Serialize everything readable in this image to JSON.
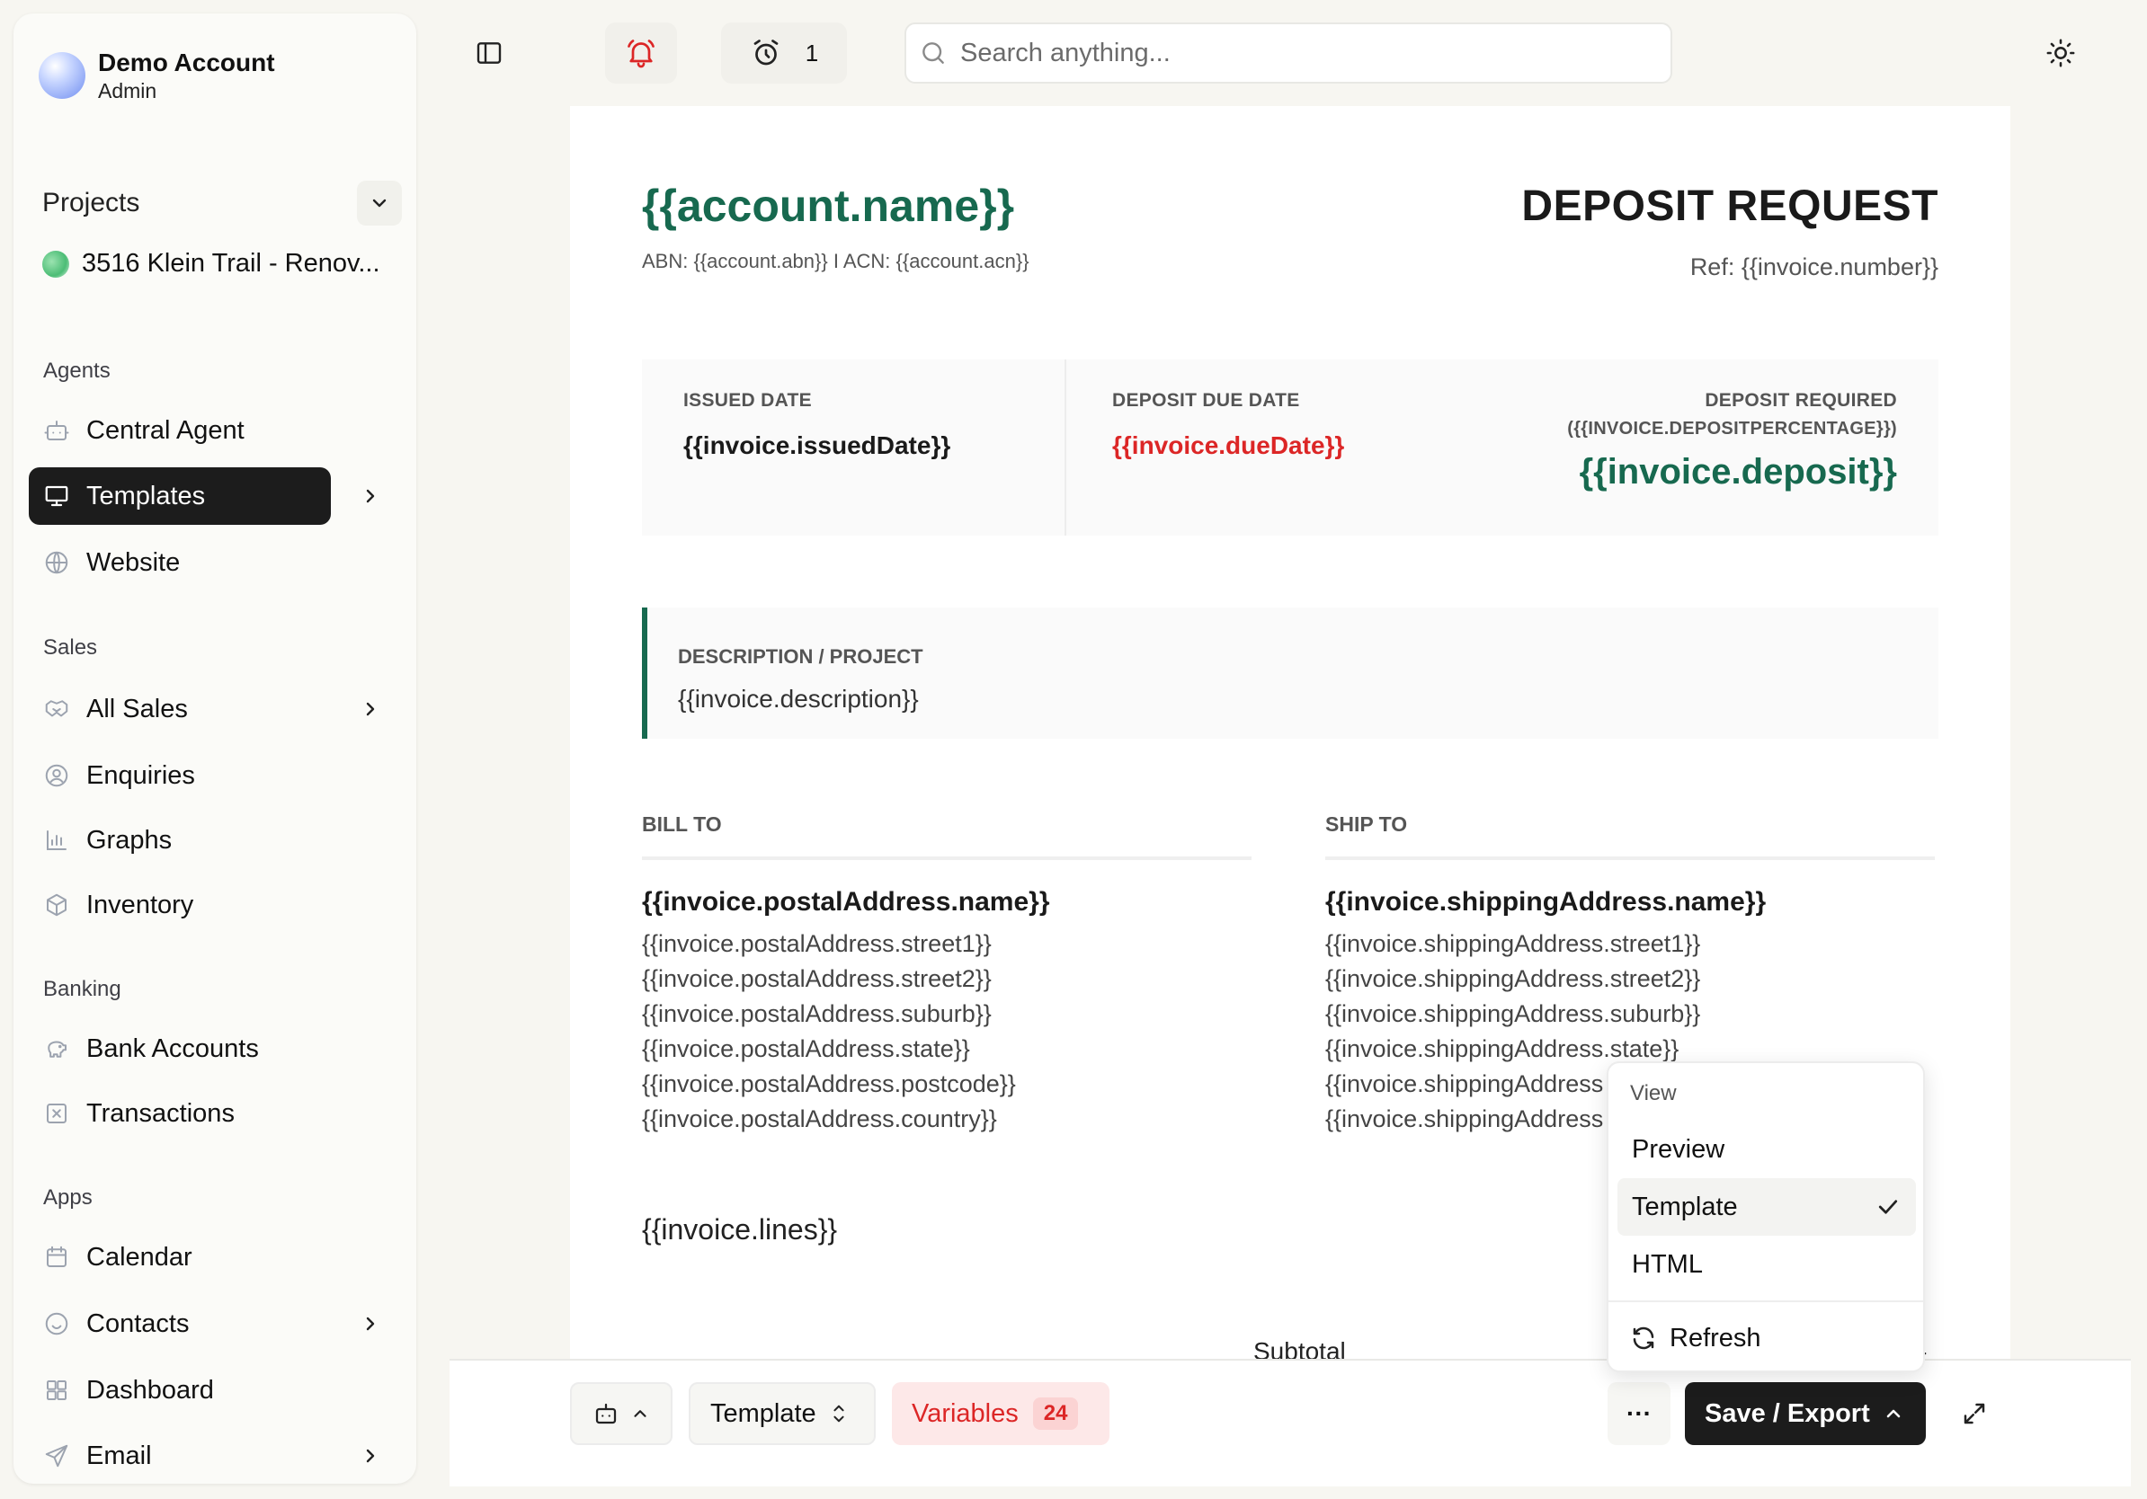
{
  "account": {
    "name": "Demo Account",
    "role": "Admin"
  },
  "projects": {
    "label": "Projects",
    "current": "3516 Klein Trail - Renov..."
  },
  "sidebar": {
    "sections": {
      "agents": "Agents",
      "sales": "Sales",
      "banking": "Banking",
      "apps": "Apps"
    },
    "items": {
      "central_agent": "Central Agent",
      "templates": "Templates",
      "website": "Website",
      "all_sales": "All Sales",
      "enquiries": "Enquiries",
      "graphs": "Graphs",
      "inventory": "Inventory",
      "bank_accounts": "Bank Accounts",
      "transactions": "Transactions",
      "calendar": "Calendar",
      "contacts": "Contacts",
      "dashboard": "Dashboard",
      "email": "Email"
    }
  },
  "topbar": {
    "alarm_count": "1",
    "search_placeholder": "Search anything..."
  },
  "document": {
    "account_name": "{{account.name}}",
    "account_sub": "ABN: {{account.abn}} I ACN: {{account.acn}}",
    "title": "DEPOSIT REQUEST",
    "ref": "Ref: {{invoice.number}}",
    "issued_label": "ISSUED DATE",
    "issued_value": "{{invoice.issuedDate}}",
    "due_label": "DEPOSIT DUE DATE",
    "due_value": "{{invoice.dueDate}}",
    "deposit_label": "DEPOSIT REQUIRED",
    "deposit_percent": "({{INVOICE.DEPOSITPERCENTAGE}})",
    "deposit_value": "{{invoice.deposit}}",
    "description_label": "DESCRIPTION / PROJECT",
    "description_value": "{{invoice.description}}",
    "bill_to": {
      "label": "BILL TO",
      "name": "{{invoice.postalAddress.name}}",
      "lines": [
        "{{invoice.postalAddress.street1}}",
        "{{invoice.postalAddress.street2}}",
        "{{invoice.postalAddress.suburb}}",
        "{{invoice.postalAddress.state}}",
        "{{invoice.postalAddress.postcode}}",
        "{{invoice.postalAddress.country}}"
      ]
    },
    "ship_to": {
      "label": "SHIP TO",
      "name": "{{invoice.shippingAddress.name}}",
      "lines": [
        "{{invoice.shippingAddress.street1}}",
        "{{invoice.shippingAddress.street2}}",
        "{{invoice.shippingAddress.suburb}}",
        "{{invoice.shippingAddress.state}}",
        "{{invoice.shippingAddress",
        "{{invoice.shippingAddress"
      ]
    },
    "lines_placeholder": "{{invoice.lines}}",
    "subtotal_label": "Subtotal",
    "subtotal_tail": "}}"
  },
  "bottombar": {
    "mode_label": "Template",
    "variables_label": "Variables",
    "variables_count": "24",
    "more_label": "···",
    "save_label": "Save / Export"
  },
  "view_menu": {
    "header": "View",
    "preview": "Preview",
    "template": "Template",
    "html": "HTML",
    "refresh": "Refresh"
  },
  "colors": {
    "brand_green": "#17694f",
    "danger_red": "#dc2626",
    "dark": "#1c1c1c"
  },
  "icons": {
    "sidebar_toggle": "sidebar-toggle-icon",
    "bell": "bell-icon",
    "alarm": "alarm-clock-icon",
    "search": "search-icon",
    "theme": "sun-icon",
    "robot": "robot-icon",
    "expand": "expand-icon"
  }
}
